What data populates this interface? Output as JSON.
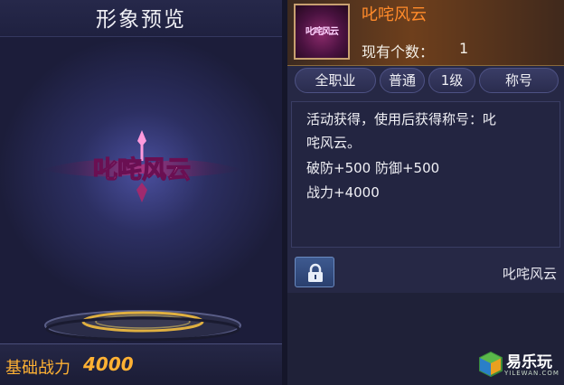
{
  "preview": {
    "title": "形象预览",
    "emblem_text": "叱咤风云",
    "power_label": "基础战力",
    "power_value": "4000"
  },
  "item": {
    "name": "叱咤风云",
    "icon_text": "叱咤风云",
    "count_label": "现有个数：",
    "count_value": "1",
    "tags": [
      "全职业",
      "普通",
      "1级",
      "称号"
    ],
    "description": [
      "活动获得，使用后获得称号：叱",
      "咤风云。",
      "破防+500 防御+500",
      "战力+4000"
    ],
    "equipped_title": "叱咤风云"
  },
  "watermark": {
    "name": "易乐玩",
    "sub": "YILEWAN.COM"
  },
  "colors": {
    "power_text": "#ffb133",
    "item_name": "#ff8a2a",
    "emblem_pink": "#ff6ad8"
  }
}
